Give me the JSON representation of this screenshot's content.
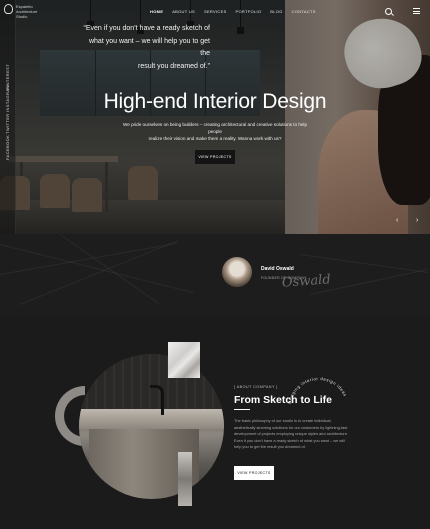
{
  "brand": {
    "name_lines": [
      "Espaletto",
      "Architecture",
      "Studio"
    ]
  },
  "nav": {
    "items": [
      "HOME",
      "ABOUT US",
      "SERVICES",
      "PORTFOLIO",
      "BLOG",
      "CONTACTS"
    ],
    "active": "HOME"
  },
  "sidebar": {
    "social": [
      "FACEBOOK",
      "TWITTER",
      "INSTAGRAM",
      "PINTEREST"
    ]
  },
  "icons": {
    "search": "search-icon",
    "menu": "hamburger-menu-icon",
    "prev": "arrow-left-icon",
    "next": "arrow-right-icon"
  },
  "hero": {
    "title": "High-end Interior Design",
    "subtitle_line1": "We pride ourselves on being builders – creating architectural and creative solutions to help people",
    "subtitle_line2": "realize their vision and make them a reality. Wanna work with us?",
    "button": "VIEW PROJECTS",
    "prev_arrow": "‹",
    "next_arrow": "›"
  },
  "quote": {
    "text_line1": "“Even if you don’t have a ready sketch of",
    "text_line2": "what you want – we will help you to get the",
    "text_line3": "result you dreamed of.”",
    "author": "David Oswald",
    "role": "FOUNDER OF COMPANY",
    "signature": "Oswald"
  },
  "about": {
    "tag": "[ ABOUT COMPANY ]",
    "title": "From Sketch to Life",
    "body": "The basic philosophy of our studio is to create individual, aesthetically stunning solutions for our customers by lightning-fast development of projects employing unique styles and architecture. Even if you don’t have a ready sketch of what you want – we will help you to get the result you dreamed of.",
    "button": "VIEW PROJECTS",
    "circle_text": "Bringing interior design ideas"
  },
  "colors": {
    "background": "#1b1b1b",
    "accent": "#ffffff"
  }
}
